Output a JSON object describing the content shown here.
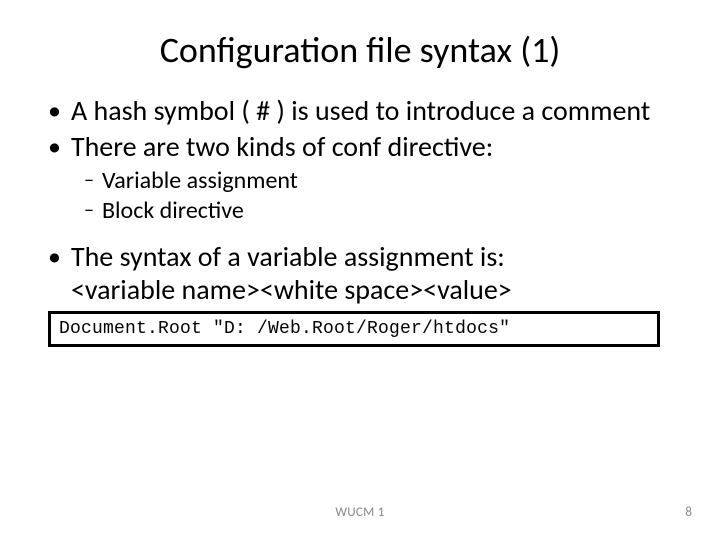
{
  "title": "Configuration file syntax (1)",
  "bullets": {
    "b1": "A hash symbol ( # ) is used to introduce a comment",
    "b2": "There are two kinds of conf directive:",
    "sub1": "Variable assignment",
    "sub2": "Block directive",
    "b3_line1": "The syntax of a variable assignment is:",
    "b3_line2": "<variable name><white space><value>"
  },
  "code": "Document.Root \"D: /Web.Root/Roger/htdocs\"",
  "footer": {
    "center": "WUCM 1",
    "page": "8"
  }
}
